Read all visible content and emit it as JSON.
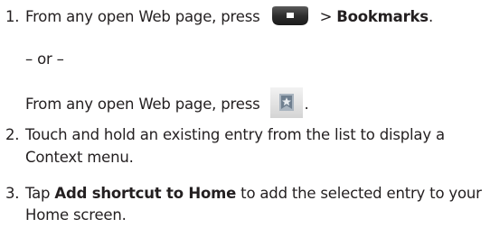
{
  "steps": [
    {
      "number": "1.",
      "text_before_icon": "From any open Web page, press",
      "icon": "menu-key-icon",
      "text_after_icon": " > ",
      "bold": "Bookmarks",
      "trailing": "."
    },
    {
      "number": "2.",
      "line1": "Touch and hold an existing entry from the list to display a",
      "line2": "Context menu."
    },
    {
      "number": "3.",
      "line1_before_bold": "Tap ",
      "line1_bold": "Add shortcut to Home",
      "line1_after_bold": " to add the selected entry to your",
      "line2": "Home screen."
    }
  ],
  "or_text": "– or –",
  "alt_instruction": {
    "text": "From any open Web page, press",
    "icon": "bookmark-icon",
    "trailing": "."
  },
  "colors": {
    "text": "#231f20",
    "menu_key_dark": "#3a3a3a",
    "bookmark_tile": "#e4e4e4"
  }
}
